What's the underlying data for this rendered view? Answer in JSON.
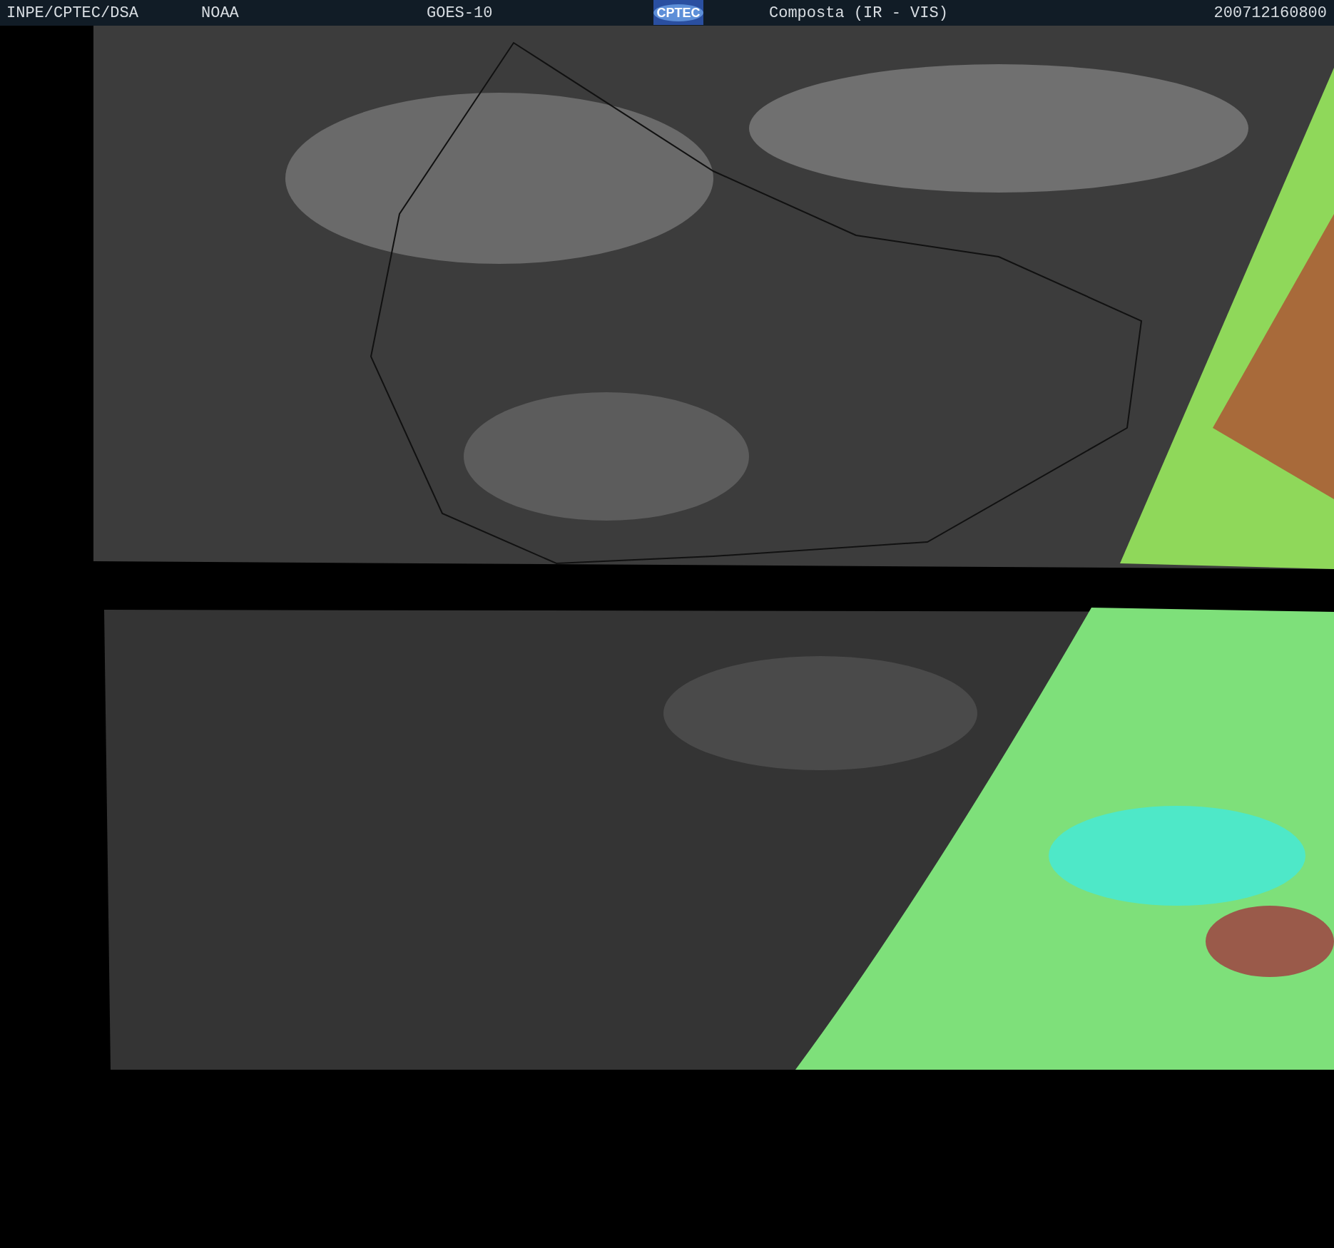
{
  "header": {
    "texts": [
      "INPE/CPTEC/DSA",
      "NOAA",
      "GOES-10"
    ],
    "logo_text": "CPTEC",
    "product": "Composta (IR - VIS)",
    "timestamp": "200712160800"
  }
}
